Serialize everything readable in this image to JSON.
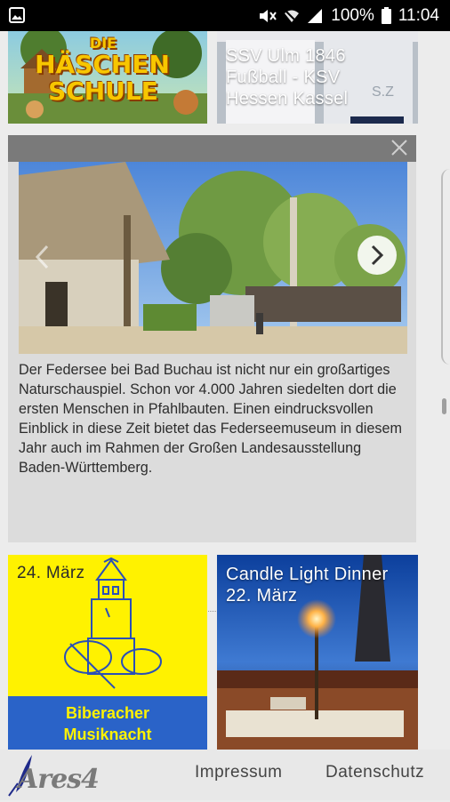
{
  "status_bar": {
    "battery": "100%",
    "time": "11:04"
  },
  "tiles": {
    "top_left": {
      "image_text": [
        "DIE",
        "HÄSCHEN",
        "SCHULE"
      ]
    },
    "top_right": {
      "text": [
        "SSV Ulm 1846",
        "Fußball  - KSV",
        "Hessen Kassel"
      ],
      "jersey_text": "S.Z"
    },
    "bottom_left": {
      "date": "24. März",
      "banner": [
        "Biberacher",
        "Musiknacht"
      ]
    },
    "bottom_right": {
      "text": [
        "Candle Light Dinner",
        "22. März"
      ]
    }
  },
  "article": {
    "text": "Der Federsee bei Bad Buchau ist nicht nur ein großartiges Naturschauspiel. Schon vor 4.000 Jahren siedelten dort die ersten Menschen in Pfahlbauten. Einen eindrucksvollen Einblick in diese Zeit bietet das Federseemuseum in diesem Jahr auch im Rahmen der Großen Landesausstellung Baden-Württemberg.",
    "share_icons": [
      "facebook-icon",
      "mail-icon",
      "print-icon"
    ]
  },
  "footer": {
    "logo": "Ares4",
    "links": [
      "Impressum",
      "Datenschutz"
    ]
  }
}
